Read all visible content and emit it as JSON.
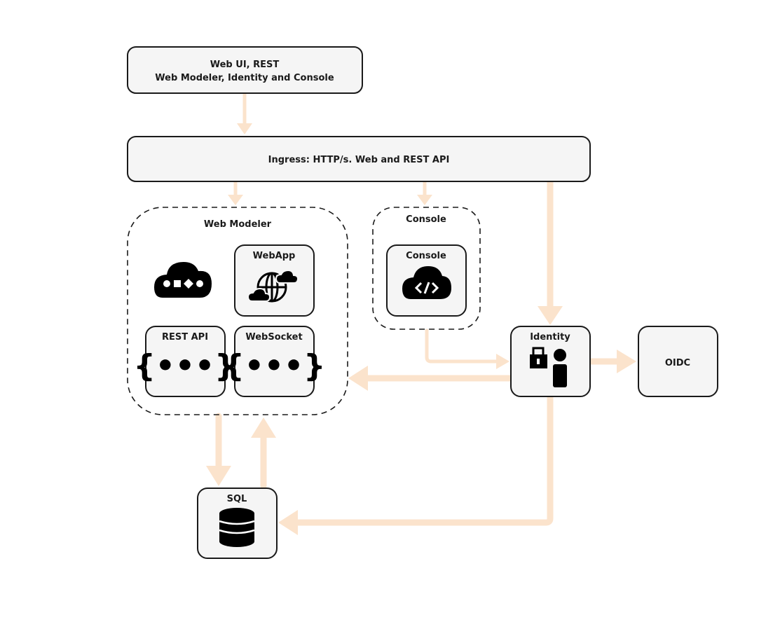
{
  "colors": {
    "arrow": "#fbe3cc",
    "box_fill": "#f5f5f5",
    "stroke": "#1a1a1a",
    "icon": "#000000"
  },
  "nodes": {
    "client": {
      "line1": "Web UI, REST",
      "line2": "Web Modeler, Identity and Console"
    },
    "ingress": {
      "label": "Ingress: HTTP/s. Web and REST API"
    },
    "web_modeler_group": {
      "label": "Web Modeler",
      "icon": "cloud-bpmn-icon"
    },
    "webapp": {
      "label": "WebApp",
      "icon": "globe-clouds-icon"
    },
    "rest_api": {
      "label": "REST API",
      "icon": "curly-braces-icon"
    },
    "websocket": {
      "label": "WebSocket",
      "icon": "curly-braces-icon"
    },
    "console_group": {
      "label": "Console"
    },
    "console": {
      "label": "Console",
      "icon": "cloud-code-icon"
    },
    "identity": {
      "label": "Identity",
      "icon": "lock-person-icon"
    },
    "oidc": {
      "label": "OIDC"
    },
    "sql": {
      "label": "SQL",
      "icon": "database-icon"
    }
  },
  "edges": [
    {
      "from": "client",
      "to": "ingress"
    },
    {
      "from": "ingress",
      "to": "web_modeler_group"
    },
    {
      "from": "ingress",
      "to": "console_group"
    },
    {
      "from": "ingress",
      "to": "identity"
    },
    {
      "from": "console_group",
      "to": "identity"
    },
    {
      "from": "identity",
      "to": "web_modeler_group"
    },
    {
      "from": "identity",
      "to": "oidc"
    },
    {
      "from": "identity",
      "to": "sql"
    },
    {
      "from": "web_modeler_group",
      "to": "sql"
    },
    {
      "from": "sql",
      "to": "web_modeler_group"
    }
  ]
}
